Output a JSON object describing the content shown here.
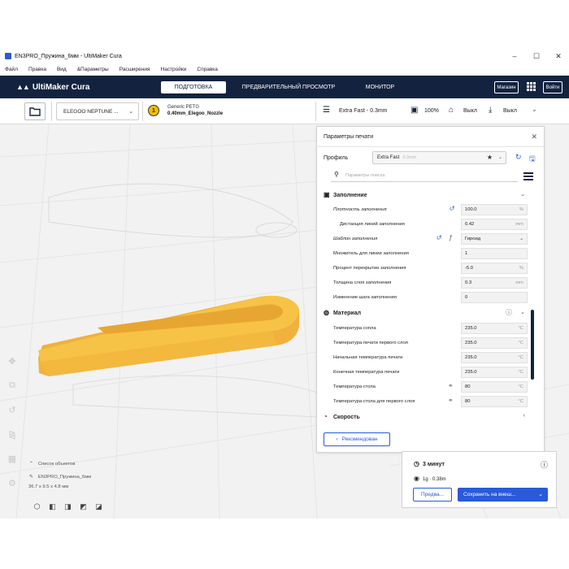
{
  "window": {
    "title": "EN3PRO_Пружина_6мм - UltiMaker Cura",
    "controls": [
      "–",
      "☐",
      "✕"
    ]
  },
  "menu": [
    "Файл",
    "Правка",
    "Вид",
    "&Параметры",
    "Расширения",
    "Настройки",
    "Справка"
  ],
  "header": {
    "logo": "UltiMaker Cura",
    "stages": [
      "ПОДГОТОВКА",
      "ПРЕДВАРИТЕЛЬНЫЙ ПРОСМОТР",
      "МОНИТОР"
    ],
    "active_stage": 0,
    "marketplace": "Магазин",
    "login": "Войти"
  },
  "toolbar": {
    "printer": "ELEGOO NEPTUNE ...",
    "extruder_number": "1",
    "material": "Generic PETG",
    "nozzle": "0.40mm_Elegoo_Nozzle",
    "profile": "Extra Fast - 0.3mm",
    "infill": "100%",
    "support": "Выкл",
    "adhesion": "Выкл"
  },
  "panel": {
    "title": "Параметры печати",
    "profile_label": "Профиль",
    "profile_value": "Extra Fast",
    "profile_sub": "0.3mm",
    "search_placeholder": "Параметры поиска",
    "recommended": "Рекомендован",
    "categories": {
      "infill": "Заполнение",
      "material": "Материал",
      "speed": "Скорость"
    },
    "infill_rows": [
      {
        "label": "Плотность заполнения",
        "value": "100.0",
        "unit": "%"
      },
      {
        "label": "Дистанция линий заполнения",
        "value": "0.42",
        "unit": "mm"
      },
      {
        "label": "Шаблон заполнения",
        "value": "Гироид",
        "unit": ""
      },
      {
        "label": "Множитель для линии заполнения",
        "value": "1",
        "unit": ""
      },
      {
        "label": "Процент перекрытие заполнения",
        "value": "-5.0",
        "unit": "%"
      },
      {
        "label": "Толщина слоя заполнения",
        "value": "0.3",
        "unit": "mm"
      },
      {
        "label": "Изменение шага заполнения",
        "value": "0",
        "unit": ""
      }
    ],
    "material_rows": [
      {
        "label": "Температура сопла",
        "value": "235.0",
        "unit": "°C"
      },
      {
        "label": "Температура печати первого слоя",
        "value": "235.0",
        "unit": "°C"
      },
      {
        "label": "Начальная температура печати",
        "value": "235.0",
        "unit": "°C"
      },
      {
        "label": "Конечная температура печати",
        "value": "235.0",
        "unit": "°C"
      },
      {
        "label": "Температура стола",
        "value": "80",
        "unit": "°C"
      },
      {
        "label": "Температура стола для первого слоя",
        "value": "80",
        "unit": "°C"
      }
    ]
  },
  "print_info": {
    "time": "3 минут",
    "material": "1g · 0.38m",
    "preview": "Предва...",
    "save": "Сохранить на внеш..."
  },
  "objects": {
    "list_label": "Список объектов",
    "file": "EN3PRO_Пружина_6мм",
    "dims": "36.7 x 9.5 x 4.8 мм"
  },
  "colors": {
    "header_bg": "#13233f",
    "accent": "#2a5ad8",
    "model": "#f7c347"
  }
}
